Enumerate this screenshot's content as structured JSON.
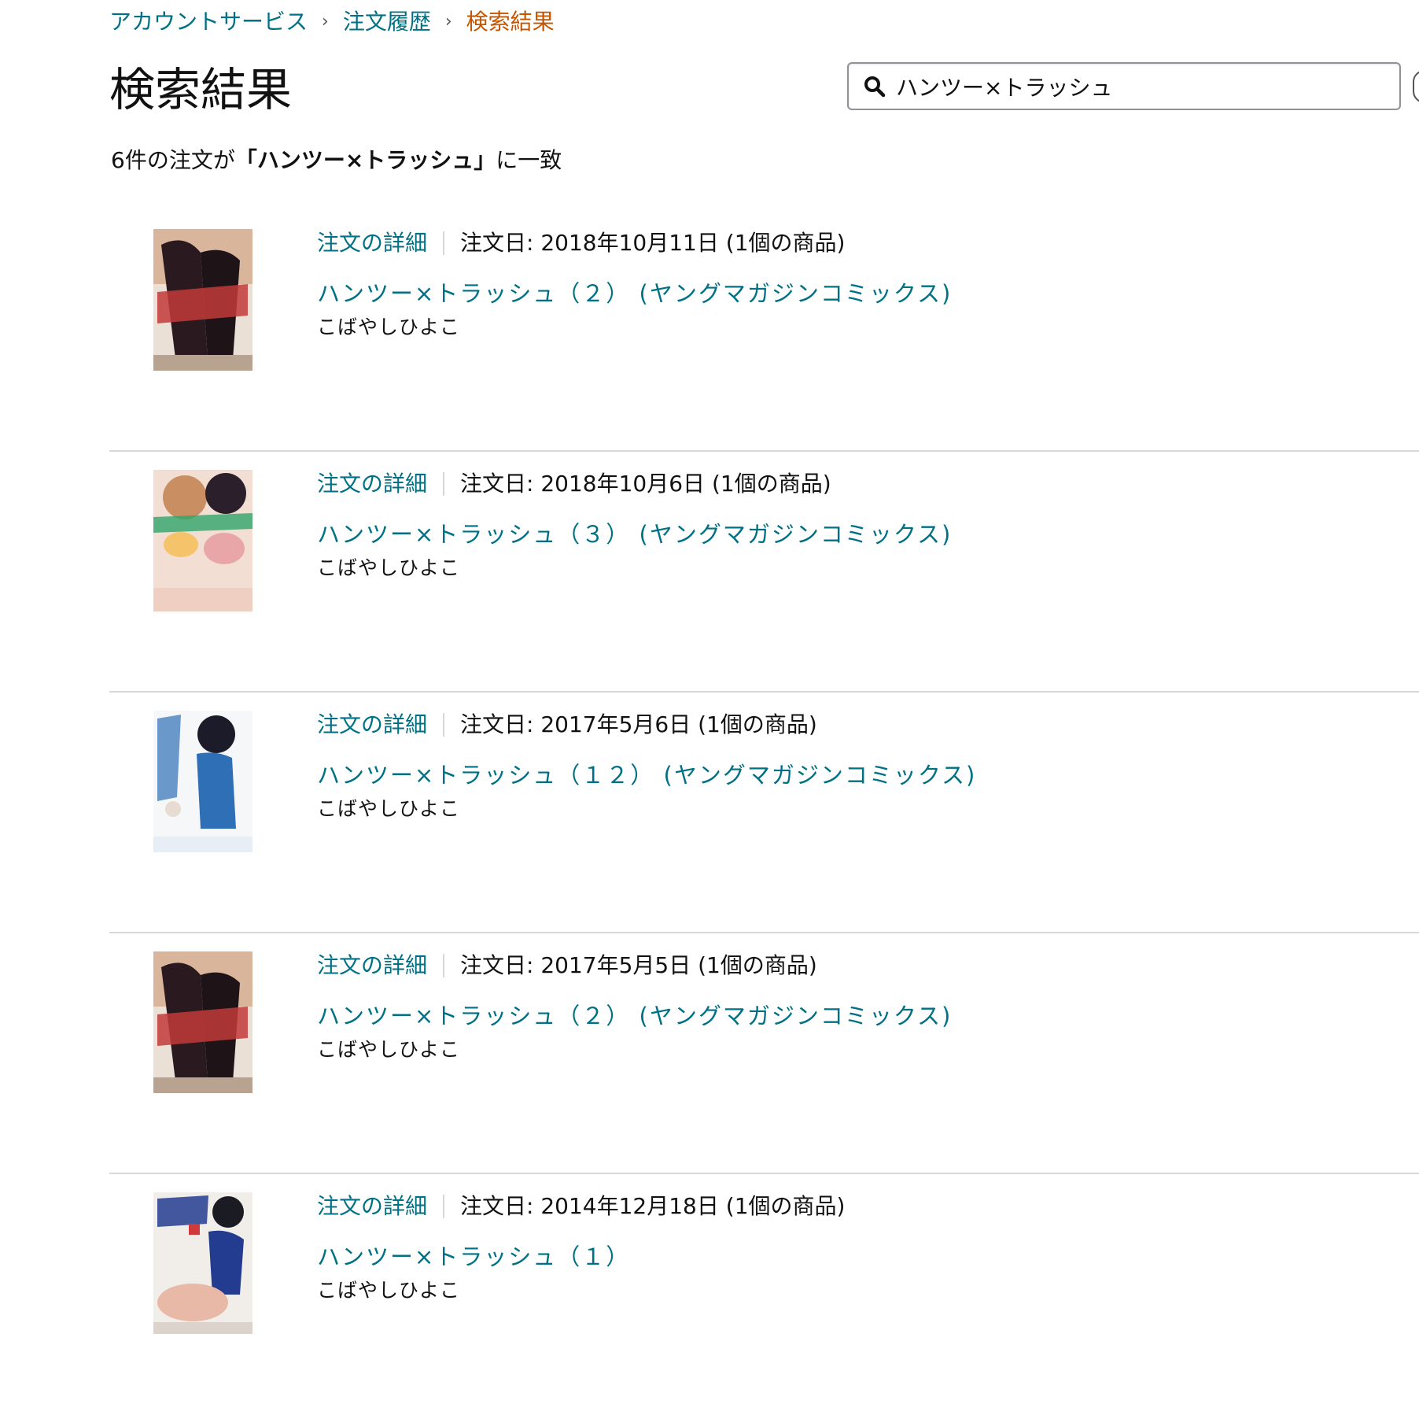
{
  "breadcrumb": {
    "items": [
      {
        "label": "アカウントサービス"
      },
      {
        "label": "注文履歴"
      }
    ],
    "current": "検索結果",
    "separator": "›"
  },
  "page_title": "検索結果",
  "search": {
    "value": "ハンツー×トラッシュ",
    "icon": "search-icon"
  },
  "summary": {
    "prefix": "6件の注文が",
    "query": "「ハンツー×トラッシュ」",
    "suffix": "に一致"
  },
  "orders": [
    {
      "details_label": "注文の詳細",
      "date": "注文日: 2018年10月11日 (1個の商品)",
      "title": "ハンツー×トラッシュ（２） (ヤングマガジンコミックス)",
      "author": "こばやしひよこ",
      "cover_colors": [
        "#2a1a1f",
        "#d9b59b",
        "#c23a3a",
        "#eae0d5"
      ]
    },
    {
      "details_label": "注文の詳細",
      "date": "注文日: 2018年10月6日 (1個の商品)",
      "title": "ハンツー×トラッシュ（３） (ヤングマガジンコミックス)",
      "author": "こばやしひよこ",
      "cover_colors": [
        "#f2ded3",
        "#e9a6a8",
        "#2ea46a",
        "#f5c36a"
      ]
    },
    {
      "details_label": "注文の詳細",
      "date": "注文日: 2017年5月6日 (1個の商品)",
      "title": "ハンツー×トラッシュ（１２） (ヤングマガジンコミックス)",
      "author": "こばやしひよこ",
      "cover_colors": [
        "#f6f7f9",
        "#2f6fb6",
        "#1b1b2a",
        "#e6dcd2"
      ]
    },
    {
      "details_label": "注文の詳細",
      "date": "注文日: 2017年5月5日 (1個の商品)",
      "title": "ハンツー×トラッシュ（２） (ヤングマガジンコミックス)",
      "author": "こばやしひよこ",
      "cover_colors": [
        "#2a1a1f",
        "#d9b59b",
        "#c23a3a",
        "#eae0d5"
      ]
    },
    {
      "details_label": "注文の詳細",
      "date": "注文日: 2014年12月18日 (1個の商品)",
      "title": "ハンツー×トラッシュ（１）",
      "author": "こばやしひよこ",
      "cover_colors": [
        "#f1ede8",
        "#233c8f",
        "#e8b9a6",
        "#cf3a3a"
      ]
    }
  ]
}
